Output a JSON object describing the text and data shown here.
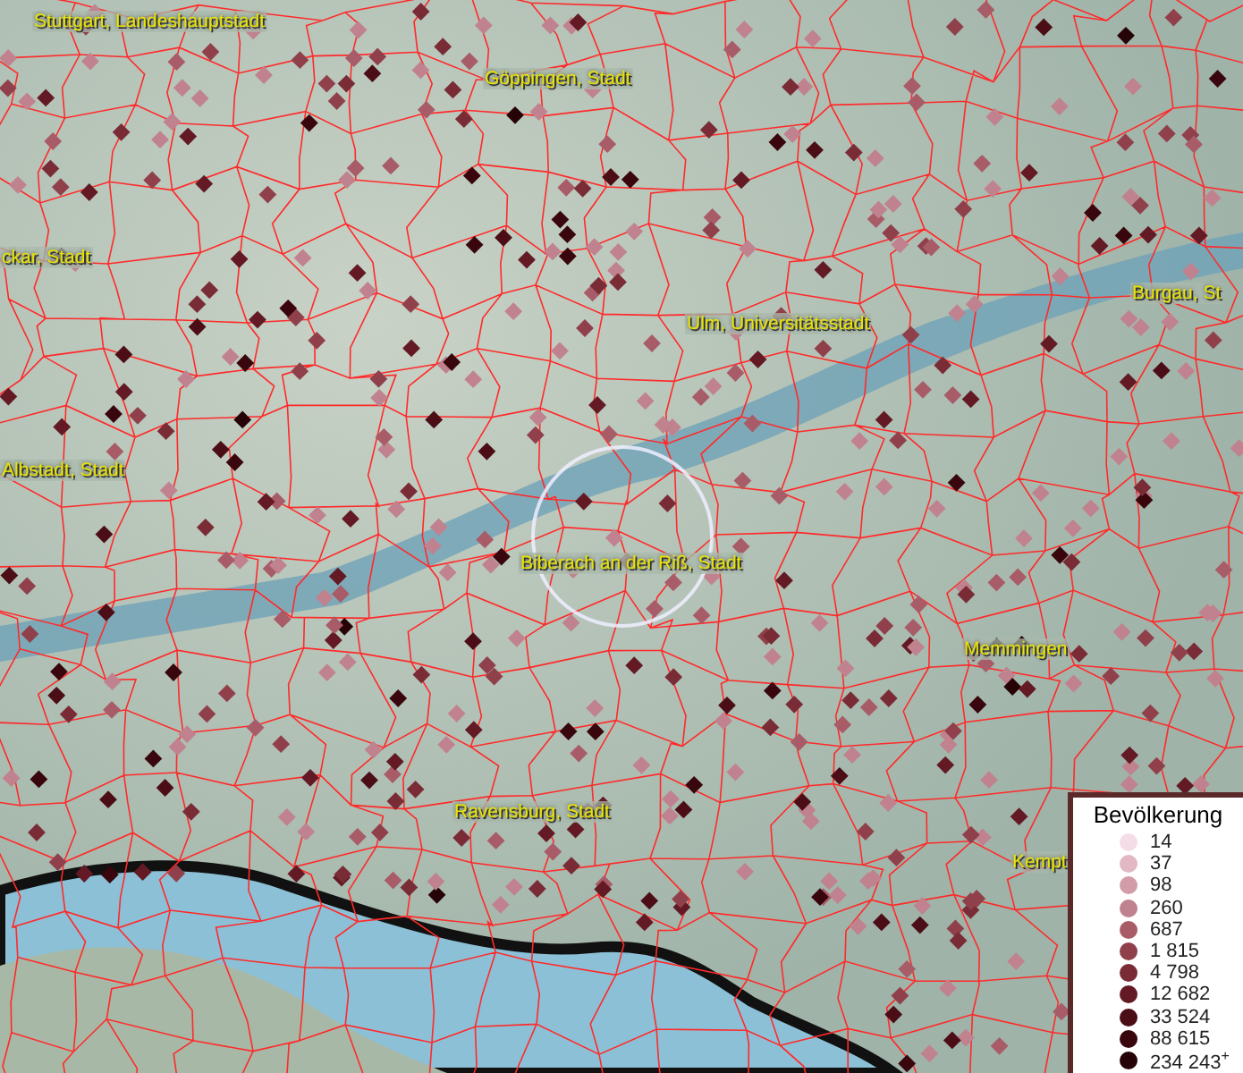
{
  "map": {
    "labels": [
      {
        "text": "Stuttgart, Landeshauptstadt"
      },
      {
        "text": "Göppingen, Stadt"
      },
      {
        "text": "ckar, Stadt"
      },
      {
        "text": "Ulm, Universitätsstadt"
      },
      {
        "text": "Burgau, St"
      },
      {
        "text": "Albstadt, Stadt"
      },
      {
        "text": "Biberach an der Riß, Stadt"
      },
      {
        "text": "Memmingen"
      },
      {
        "text": "Ravensburg, Stadt"
      },
      {
        "text": "Kempt"
      }
    ]
  },
  "legend": {
    "title": "Bevölkerung",
    "items": [
      {
        "label": "14",
        "color": "#f5dde8"
      },
      {
        "label": "37",
        "color": "#e2b8c4"
      },
      {
        "label": "98",
        "color": "#d29ca8"
      },
      {
        "label": "260",
        "color": "#c0828e"
      },
      {
        "label": "687",
        "color": "#a85c68"
      },
      {
        "label": "1 815",
        "color": "#90404b"
      },
      {
        "label": "4 798",
        "color": "#7a2c36"
      },
      {
        "label": "12 682",
        "color": "#631a24"
      },
      {
        "label": "33 524",
        "color": "#4c0e16"
      },
      {
        "label": "88 615",
        "color": "#38060c"
      },
      {
        "label": "234 243$^{+}$",
        "color": "#260306"
      }
    ]
  }
}
